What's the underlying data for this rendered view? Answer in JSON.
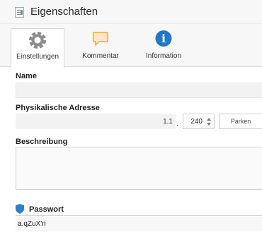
{
  "window": {
    "title": "Eigenschaften"
  },
  "tabs": [
    {
      "label": "Einstellungen",
      "icon": "gear-icon",
      "active": true
    },
    {
      "label": "Kommentar",
      "icon": "comment-icon",
      "active": false
    },
    {
      "label": "Information",
      "icon": "info-icon",
      "active": false
    }
  ],
  "info_icon_glyph": "i",
  "fields": {
    "name_label": "Name",
    "name_value": "",
    "address_label": "Physikalische Adresse",
    "address_prefix": "1.1",
    "address_separator": ".",
    "address_device": "240",
    "park_button": "Parken",
    "description_label": "Beschreibung",
    "description_value": "",
    "password_label": "Passwort",
    "password_value": "a.qZuX'n"
  },
  "colors": {
    "accent": "#1f78c8",
    "comment": "#f2a64a",
    "shield": "#2c7fd1"
  }
}
